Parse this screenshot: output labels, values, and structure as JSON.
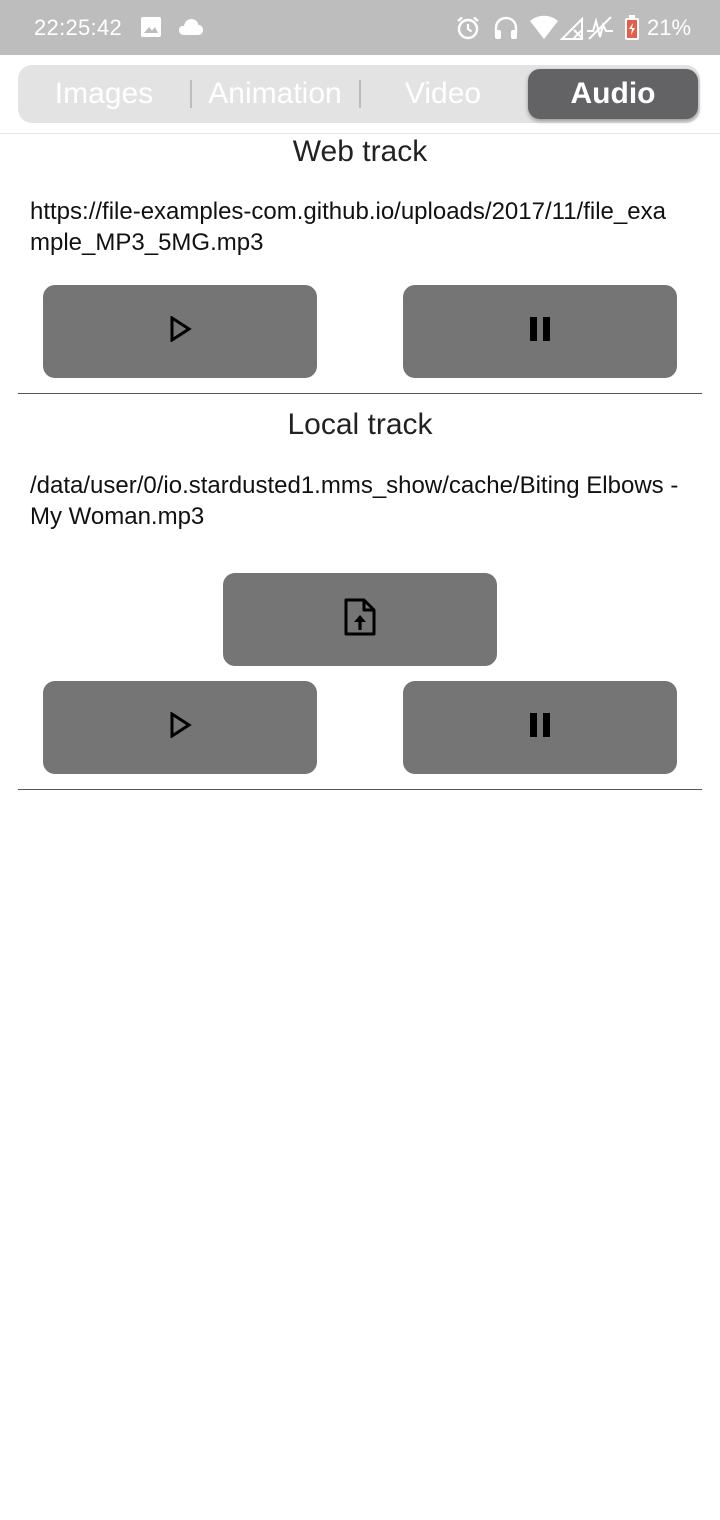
{
  "status_bar": {
    "time": "22:25:42",
    "battery_percent": "21%",
    "battery_color": "#e45d4d",
    "icons": [
      "image-icon",
      "cloud-icon",
      "alarm-icon",
      "headphones-icon",
      "wifi-icon",
      "signal-icon",
      "activity-icon",
      "battery-icon"
    ]
  },
  "tabs": {
    "items": [
      {
        "label": "Images"
      },
      {
        "label": "Animation"
      },
      {
        "label": "Video"
      },
      {
        "label": "Audio"
      }
    ],
    "selected": "Audio",
    "selected_color": "#636366"
  },
  "web_track": {
    "title": "Web track",
    "path": "https://file-examples-com.github.io/uploads/2017/11/file_example_MP3_5MG.mp3",
    "play_icon": "play-icon",
    "pause_icon": "pause-icon"
  },
  "local_track": {
    "title": "Local track",
    "path": "/data/user/0/io.stardusted1.mms_show/cache/Biting Elbows - My Woman.mp3",
    "upload_icon": "file-upload-icon",
    "play_icon": "play-icon",
    "pause_icon": "pause-icon"
  },
  "colors": {
    "button_bg": "#757575",
    "status_bar_bg": "#bdbdbd"
  }
}
